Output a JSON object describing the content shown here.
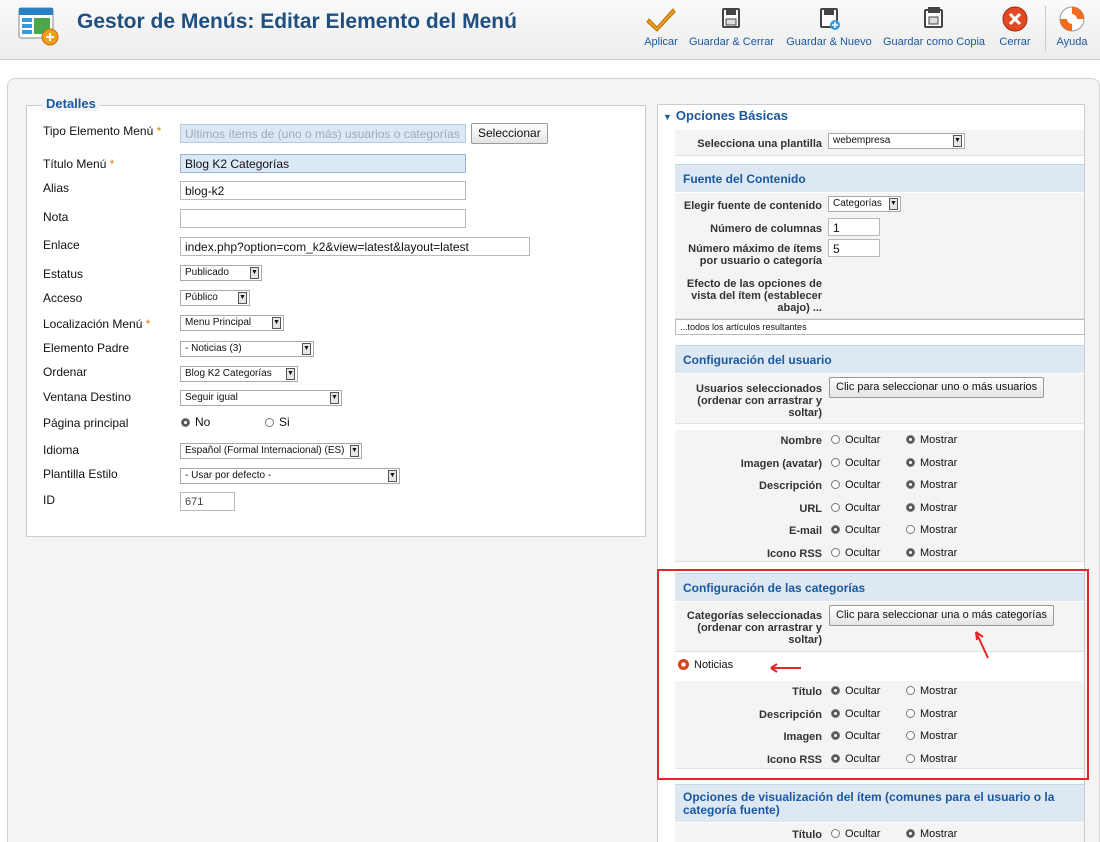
{
  "header": {
    "title": "Gestor de Menús: Editar Elemento del Menú",
    "buttons": [
      "Aplicar",
      "Guardar & Cerrar",
      "Guardar & Nuevo",
      "Guardar como Copia",
      "Cerrar",
      "Ayuda"
    ]
  },
  "details": {
    "legend": "Detalles",
    "required_mark": "*",
    "fields": {
      "tipo": {
        "label": "Tipo Elemento Menú",
        "placeholder": "Ultimos ítems de (uno o más) usuarios o categorías",
        "button": "Seleccionar"
      },
      "titulo": {
        "label": "Título Menú",
        "value": "Blog K2 Categorías"
      },
      "alias": {
        "label": "Alias",
        "value": "blog-k2"
      },
      "nota": {
        "label": "Nota",
        "value": ""
      },
      "enlace": {
        "label": "Enlace",
        "value": "index.php?option=com_k2&view=latest&layout=latest"
      },
      "estatus": {
        "label": "Estatus",
        "value": "Publicado"
      },
      "acceso": {
        "label": "Acceso",
        "value": "Público"
      },
      "localizacion": {
        "label": "Localización Menú",
        "value": "Menu Principal"
      },
      "padre": {
        "label": "Elemento Padre",
        "value": "- Noticias (3)"
      },
      "ordenar": {
        "label": "Ordenar",
        "value": "Blog K2 Categorías"
      },
      "ventana": {
        "label": "Ventana Destino",
        "value": "Seguir igual"
      },
      "principal": {
        "label": "Página principal",
        "no": "No",
        "si": "Si"
      },
      "idioma": {
        "label": "Idioma",
        "value": "Español (Formal Internacional) (ES)"
      },
      "plantilla": {
        "label": "Plantilla Estilo",
        "value": "- Usar por defecto -"
      },
      "id": {
        "label": "ID",
        "value": "671"
      }
    }
  },
  "options": {
    "title": "Opciones Básicas",
    "plantilla": {
      "label": "Selecciona una plantilla",
      "value": "webempresa"
    },
    "fuente": {
      "title": "Fuente del Contenido",
      "elegir_label": "Elegir fuente de contenido",
      "elegir_value": "Categorías",
      "columnas_label": "Número de columnas",
      "columnas_value": "1",
      "maximo_label": "Número máximo de ítems por usuario o categoría",
      "maximo_value": "5",
      "efecto_label": "Efecto de las opciones de vista del ítem (establecer abajo) ...",
      "efecto_value": "...todos los artículos resultantes"
    },
    "usuario": {
      "title": "Configuración del usuario",
      "sel_label": "Usuarios seleccionados (ordenar con arrastrar y soltar)",
      "sel_button": "Clic para seleccionar uno o más usuarios",
      "rows": [
        {
          "label": "Nombre",
          "state": "Mostrar"
        },
        {
          "label": "Imagen (avatar)",
          "state": "Mostrar"
        },
        {
          "label": "Descripción",
          "state": "Mostrar"
        },
        {
          "label": "URL",
          "state": "Mostrar"
        },
        {
          "label": "E-mail",
          "state": "Ocultar"
        },
        {
          "label": "Icono RSS",
          "state": "Mostrar"
        }
      ]
    },
    "categorias": {
      "title": "Configuración de las categorías",
      "sel_label": "Categorías seleccionadas (ordenar con arrastrar y soltar)",
      "sel_button": "Clic para seleccionar una o más categorías",
      "item": "Noticias",
      "rows": [
        {
          "label": "Título",
          "state": "Ocultar"
        },
        {
          "label": "Descripción",
          "state": "Ocultar"
        },
        {
          "label": "Imagen",
          "state": "Ocultar"
        },
        {
          "label": "Icono RSS",
          "state": "Ocultar"
        }
      ]
    },
    "visualizacion": {
      "title": "Opciones de visualización del ítem (comunes para el usuario o la categoría fuente)",
      "rows": [
        {
          "label": "Título",
          "state": "Mostrar"
        }
      ]
    },
    "ocultar": "Ocultar",
    "mostrar": "Mostrar"
  },
  "colors": {
    "accent": "#1a58a0",
    "title": "#1f4f7f",
    "highlight": "#e3262a",
    "star": "#e08000"
  }
}
